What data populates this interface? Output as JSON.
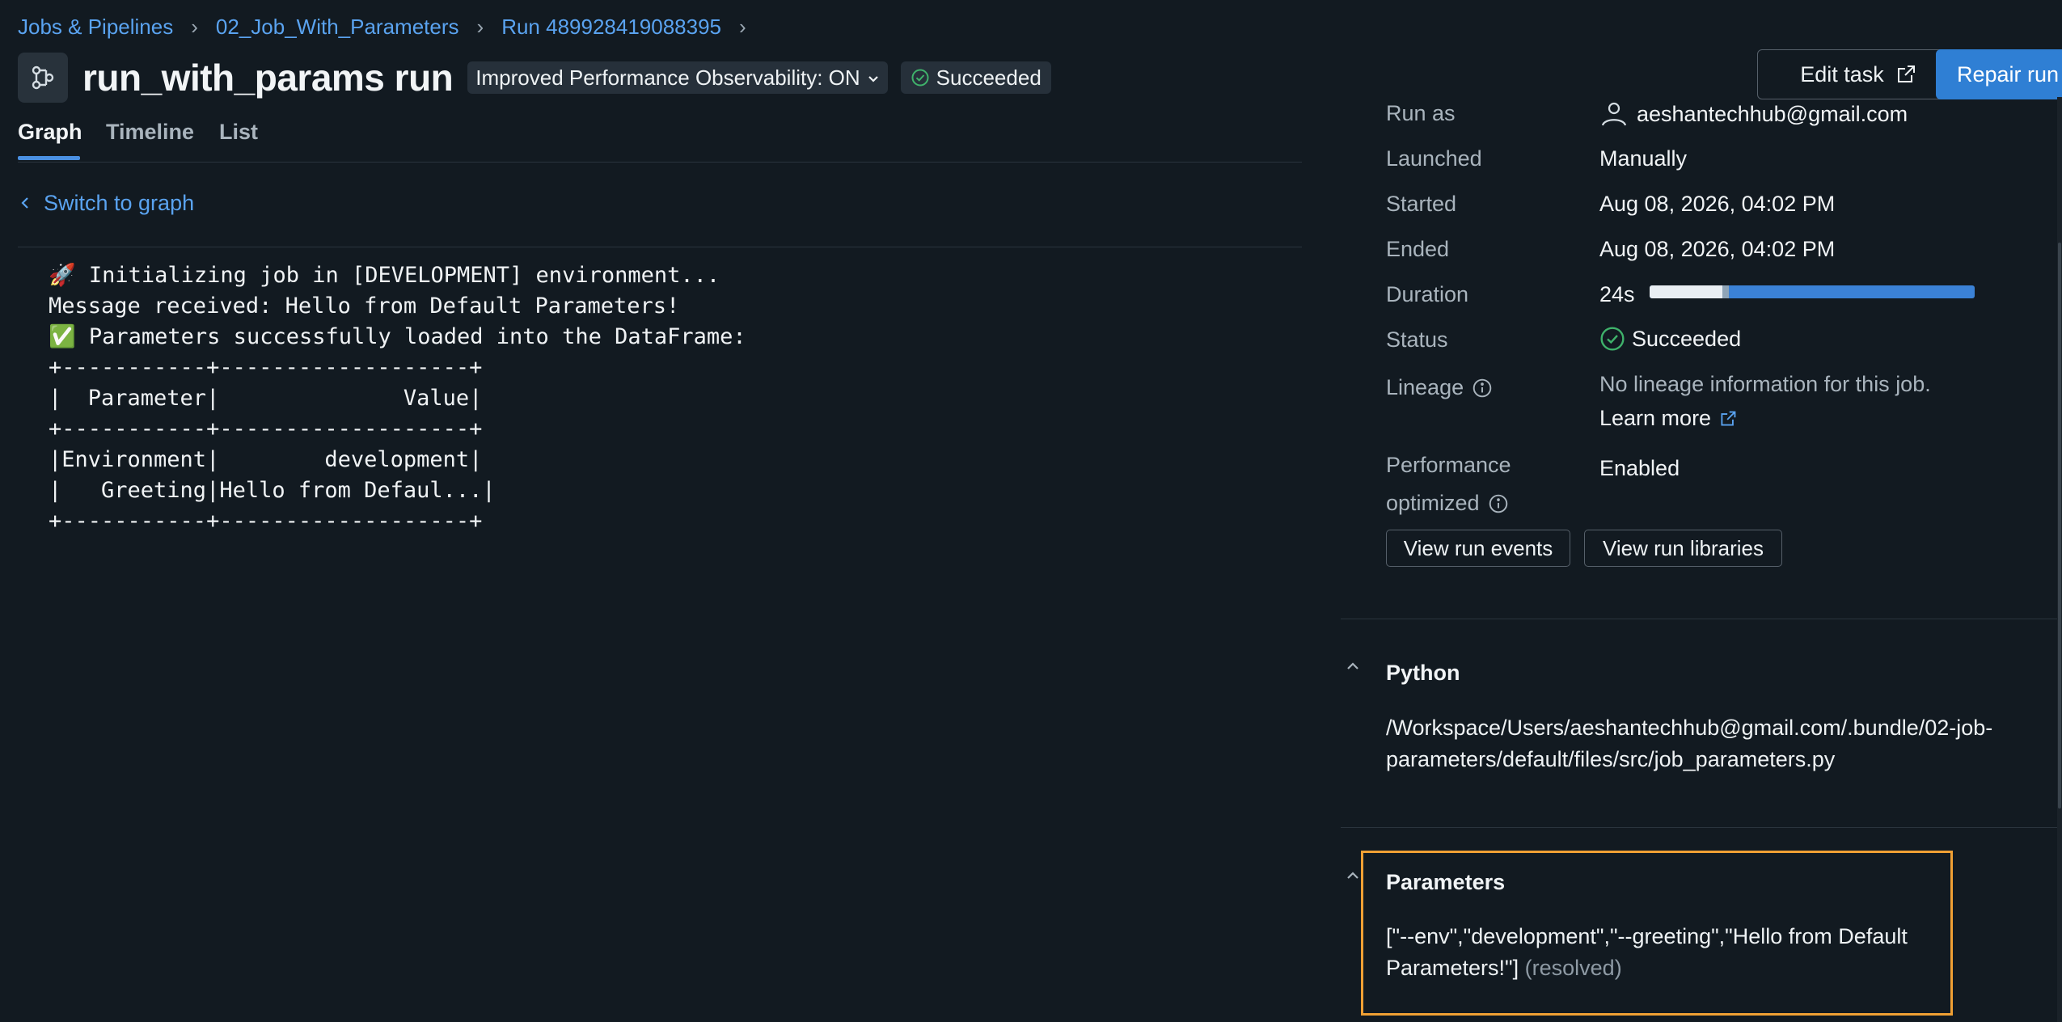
{
  "breadcrumb": {
    "items": [
      "Jobs & Pipelines",
      "02_Job_With_Parameters",
      "Run 489928419088395"
    ]
  },
  "header": {
    "title": "run_with_params run",
    "observability_label": "Improved Performance Observability: ON",
    "status_label": "Succeeded"
  },
  "tabs": [
    {
      "label": "Graph",
      "active": true
    },
    {
      "label": "Timeline",
      "active": false
    },
    {
      "label": "List",
      "active": false
    }
  ],
  "switch_link": "Switch to graph",
  "output_lines": [
    "🚀 Initializing job in [DEVELOPMENT] environment...",
    "Message received: Hello from Default Parameters!",
    "✅ Parameters successfully loaded into the DataFrame:",
    "+-----------+-------------------+",
    "|  Parameter|              Value|",
    "+-----------+-------------------+",
    "|Environment|        development|",
    "|   Greeting|Hello from Defaul...|",
    "+-----------+-------------------+"
  ],
  "actions": {
    "edit_task": "Edit task",
    "repair_run": "Repair run"
  },
  "details": {
    "run_as_label": "Run as",
    "run_as_value": "aeshantechhub@gmail.com",
    "launched_label": "Launched",
    "launched_value": "Manually",
    "started_label": "Started",
    "started_value": "Aug 08, 2026, 04:02 PM",
    "ended_label": "Ended",
    "ended_value": "Aug 08, 2026, 04:02 PM",
    "duration_label": "Duration",
    "duration_value": "24s",
    "status_label": "Status",
    "status_value": "Succeeded",
    "lineage_label": "Lineage",
    "lineage_value": "No lineage information for this job.",
    "learn_more": "Learn more",
    "perf_label_1": "Performance",
    "perf_label_2": "optimized",
    "perf_value": "Enabled",
    "view_events": "View run events",
    "view_libraries": "View run libraries"
  },
  "python_section": {
    "title": "Python",
    "path_line1": "/Workspace/Users/aeshantechhub@gmail.com/.bundle/02-job-",
    "path_line2": "parameters/default/files/src/job_parameters.py"
  },
  "parameters_section": {
    "title": "Parameters",
    "value_line1": "[\"--env\",\"development\",\"--greeting\",\"Hello from Default",
    "value_line2": "Parameters!\"]",
    "resolved": "(resolved)"
  },
  "colors": {
    "background": "#121a21",
    "link": "#5aa3f0",
    "primary": "#2f7fd4",
    "success": "#3fb26b",
    "highlight_border": "#f0a034"
  }
}
